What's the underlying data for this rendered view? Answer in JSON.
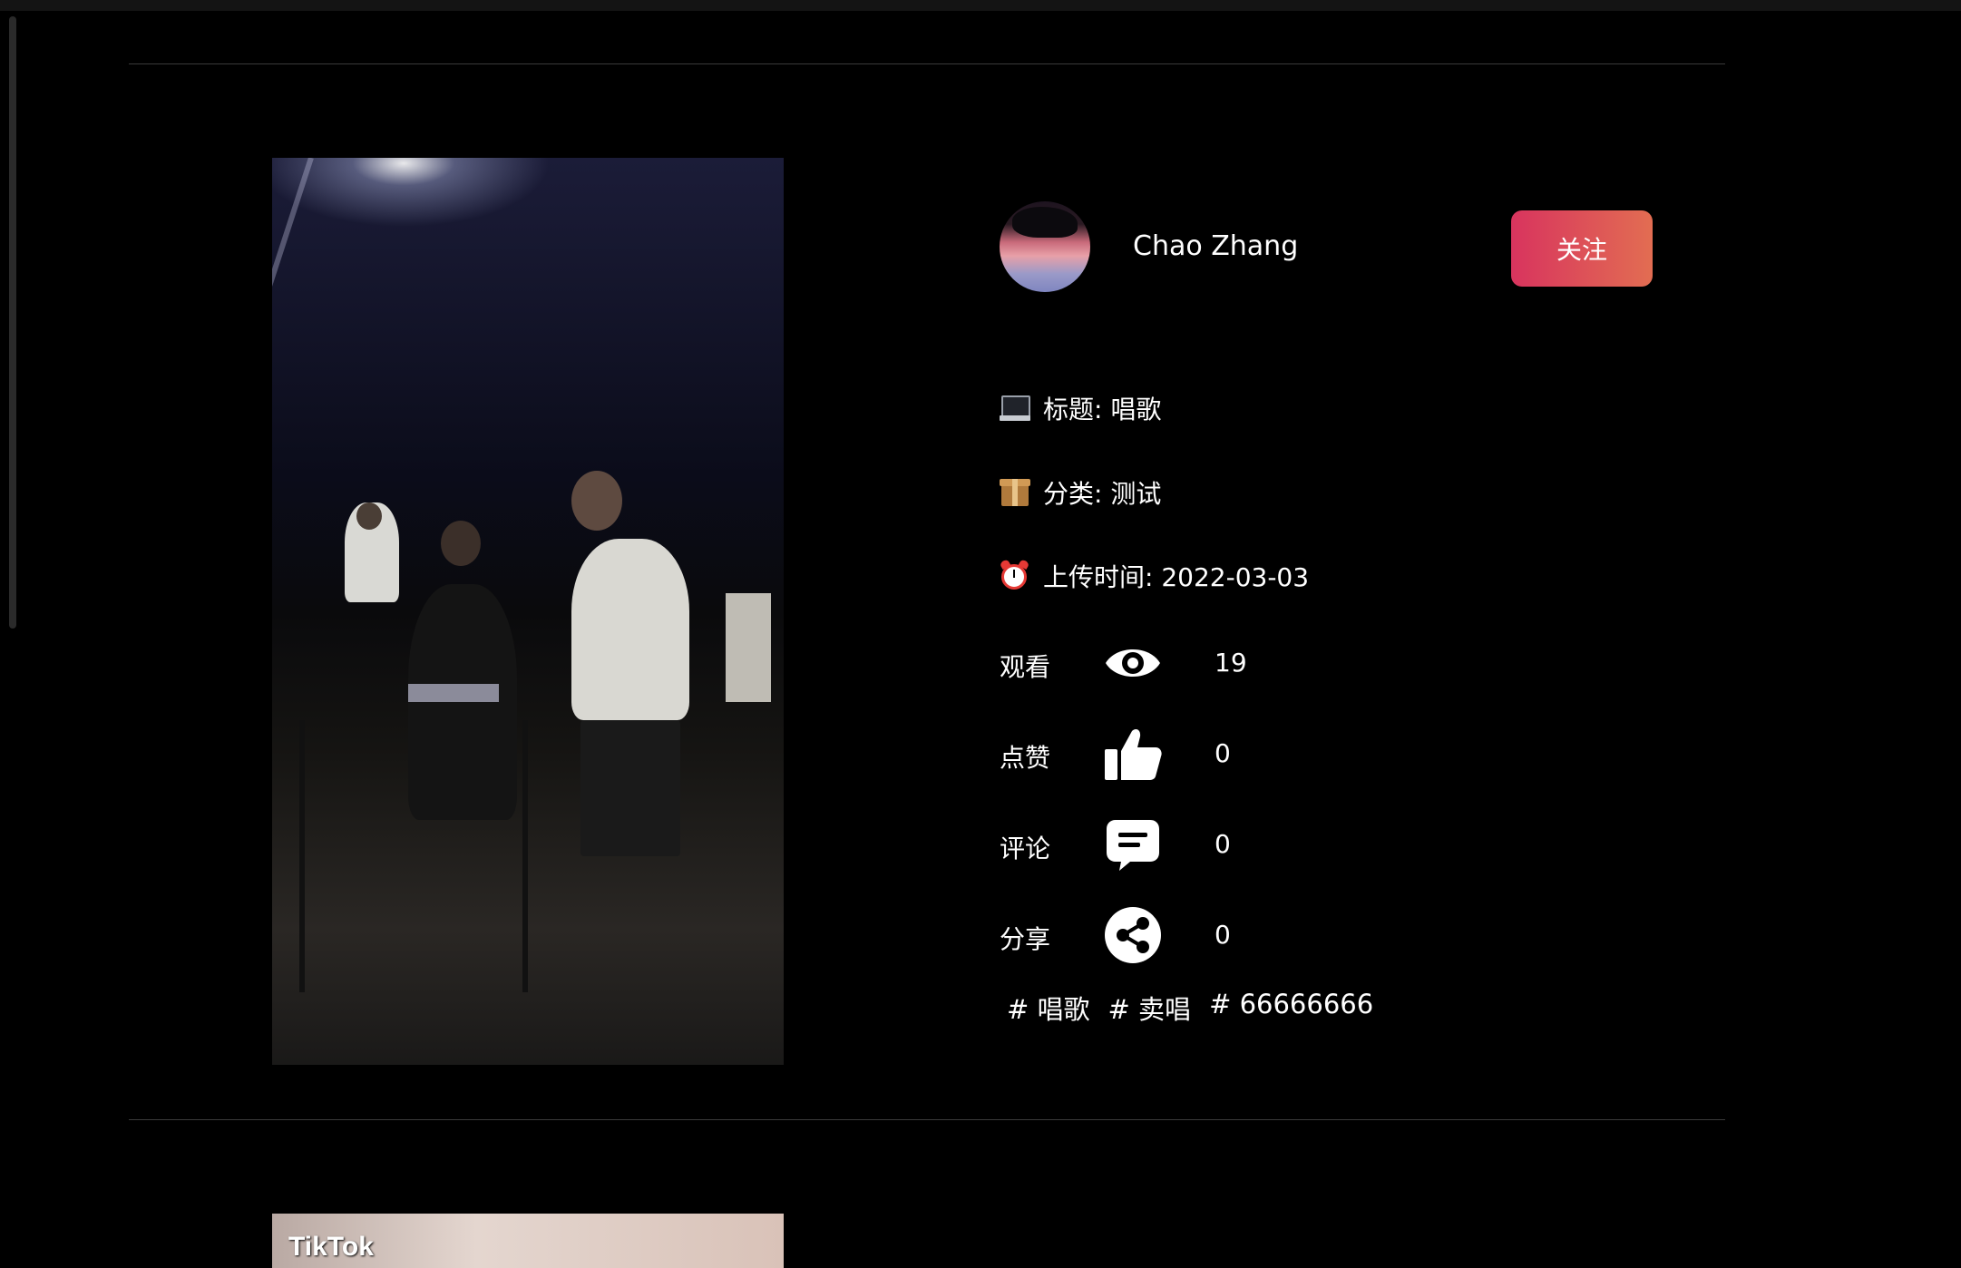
{
  "video": {
    "author": {
      "name": "Chao Zhang",
      "follow_label": "关注"
    },
    "info": {
      "title_label": "标题: 唱歌",
      "category_label": "分类: 测试",
      "upload_label": "上传时间: 2022-03-03"
    },
    "stats": {
      "views": {
        "label": "观看",
        "count": "19",
        "icon": "eye-icon"
      },
      "likes": {
        "label": "点赞",
        "count": "0",
        "icon": "thumbs-up-icon"
      },
      "comments": {
        "label": "评论",
        "count": "0",
        "icon": "comment-icon"
      },
      "shares": {
        "label": "分享",
        "count": "0",
        "icon": "share-icon"
      }
    },
    "tags": [
      "# 唱歌",
      "# 卖唱",
      "# 66666666"
    ]
  },
  "next_video": {
    "watermark": "TikTok"
  }
}
